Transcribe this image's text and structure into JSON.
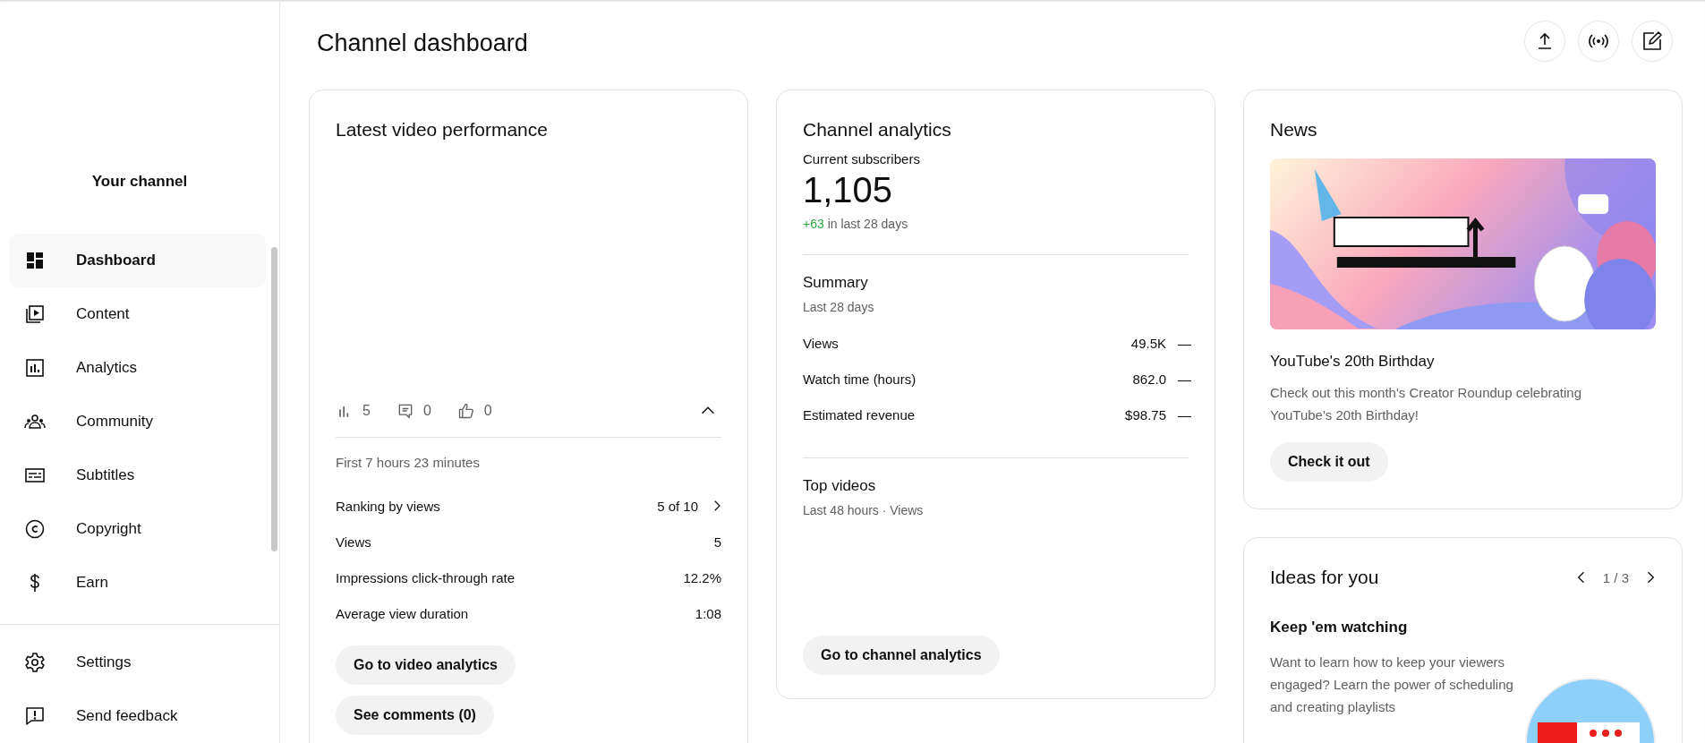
{
  "sidebar": {
    "channel_label": "Your channel",
    "items": [
      {
        "label": "Dashboard",
        "kind": "dashboard",
        "selected": true
      },
      {
        "label": "Content",
        "kind": "content",
        "selected": false
      },
      {
        "label": "Analytics",
        "kind": "analytics",
        "selected": false
      },
      {
        "label": "Community",
        "kind": "community",
        "selected": false
      },
      {
        "label": "Subtitles",
        "kind": "subtitles",
        "selected": false
      },
      {
        "label": "Copyright",
        "kind": "copyright",
        "selected": false
      },
      {
        "label": "Earn",
        "kind": "earn",
        "selected": false
      }
    ],
    "footer_items": [
      {
        "label": "Settings",
        "kind": "settings"
      },
      {
        "label": "Send feedback",
        "kind": "feedback"
      }
    ]
  },
  "header": {
    "title": "Channel dashboard",
    "actions": [
      {
        "kind": "upload"
      },
      {
        "kind": "live"
      },
      {
        "kind": "edit"
      }
    ]
  },
  "latest_video": {
    "title": "Latest video performance",
    "stats": [
      {
        "kind": "views",
        "value": "5"
      },
      {
        "kind": "comments",
        "value": "0"
      },
      {
        "kind": "likes",
        "value": "0"
      }
    ],
    "expanded": true,
    "period": "First 7 hours 23 minutes",
    "metrics": [
      {
        "label": "Ranking by views",
        "value": "5 of 10",
        "kind": "link"
      },
      {
        "label": "Views",
        "value": "5",
        "kind": "plain"
      },
      {
        "label": "Impressions click-through rate",
        "value": "12.2%",
        "kind": "plain"
      },
      {
        "label": "Average view duration",
        "value": "1:08",
        "kind": "plain"
      }
    ],
    "buttons": [
      "Go to video analytics",
      "See comments (0)"
    ]
  },
  "channel_analytics": {
    "title": "Channel analytics",
    "subscribers_label": "Current subscribers",
    "subscribers": "1,105",
    "change": "+63",
    "change_suffix": "in last 28 days",
    "summary": {
      "title": "Summary",
      "period": "Last 28 days",
      "rows": [
        {
          "label": "Views",
          "value": "49.5K",
          "trend": "—"
        },
        {
          "label": "Watch time (hours)",
          "value": "862.0",
          "trend": "—"
        },
        {
          "label": "Estimated revenue",
          "value": "$98.75",
          "trend": "—"
        }
      ]
    },
    "top_videos": {
      "title": "Top videos",
      "period": "Last 48 hours · Views"
    },
    "button": "Go to channel analytics"
  },
  "news": {
    "title": "News",
    "headline": "YouTube's 20th Birthday",
    "text": "Check out this month's Creator Roundup celebrating YouTube's 20th Birthday!",
    "button": "Check it out"
  },
  "ideas": {
    "title": "Ideas for you",
    "position": "1 / 3",
    "idea_title": "Keep 'em watching",
    "text": "Want to learn how to keep your viewers engaged? Learn the power of scheduling and creating playlists"
  }
}
